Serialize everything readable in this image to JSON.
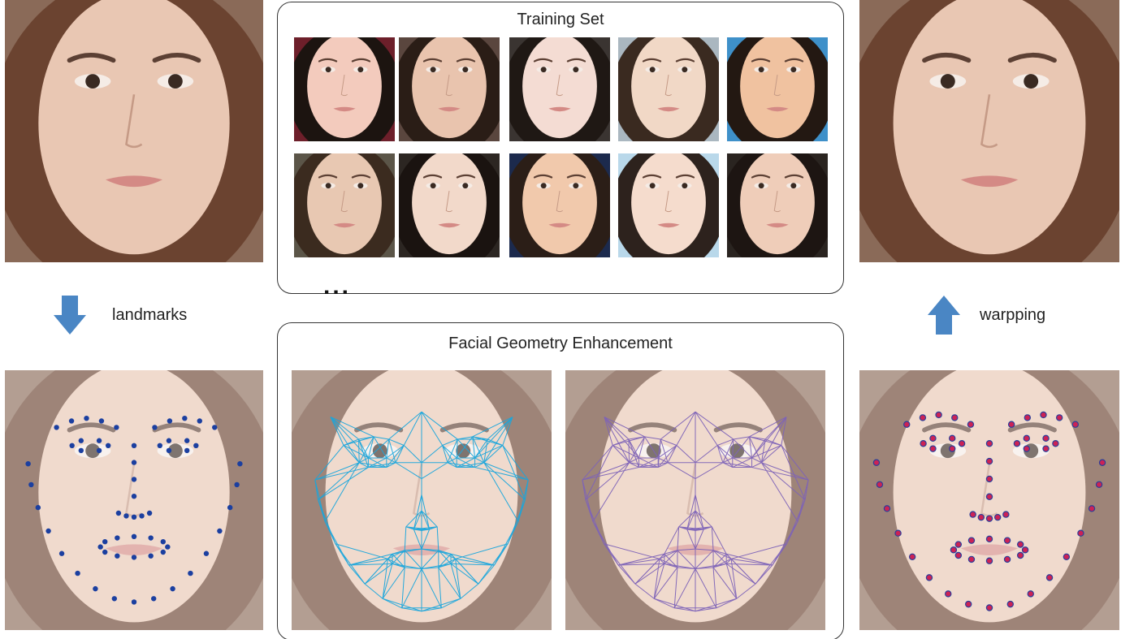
{
  "training_set": {
    "title": "Training Set",
    "thumbnails": [
      {
        "bg": "#6d1f2a",
        "hair": "#1c1410",
        "skin": "#f3cbbd"
      },
      {
        "bg": "#5a463e",
        "hair": "#2a1d16",
        "skin": "#e9c4ae"
      },
      {
        "bg": "#3a3431",
        "hair": "#1f1814",
        "skin": "#f4dcd3"
      },
      {
        "bg": "#aab7c0",
        "hair": "#3a2a20",
        "skin": "#f1d8c6"
      },
      {
        "bg": "#3e90c9",
        "hair": "#231812",
        "skin": "#f0c2a0"
      },
      {
        "bg": "#5b5548",
        "hair": "#3b2b1f",
        "skin": "#e8c8b2"
      },
      {
        "bg": "#2c2622",
        "hair": "#1a1310",
        "skin": "#f2d9ca"
      },
      {
        "bg": "#1c2a4d",
        "hair": "#2b1e17",
        "skin": "#f1c9ac"
      },
      {
        "bg": "#b9d8ea",
        "hair": "#2d221d",
        "skin": "#f5dccd"
      },
      {
        "bg": "#2a2420",
        "hair": "#1d1512",
        "skin": "#efcdb9"
      }
    ],
    "more": "..."
  },
  "enhancement": {
    "title": "Facial Geometry Enhancement",
    "mesh_colors": [
      "#1aa6dc",
      "#7e63b8"
    ]
  },
  "steps": {
    "landmarks_label": "landmarks",
    "warping_label": "warpping"
  },
  "colors": {
    "arrow": "#4a86c4",
    "landmark_dot": "#1b3fa0",
    "warped_dot_fill": "#cc2255",
    "warped_dot_ring": "#2a3e9a"
  }
}
